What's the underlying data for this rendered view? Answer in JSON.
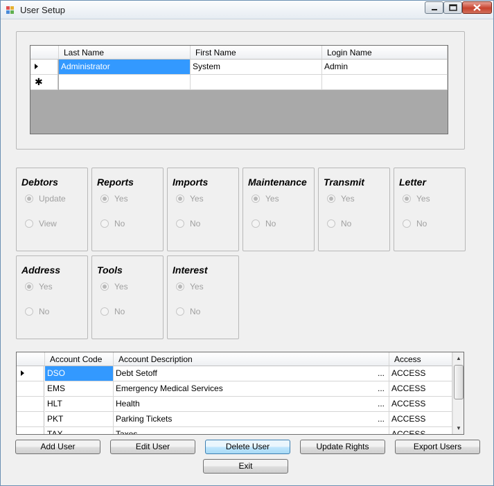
{
  "window": {
    "title": "User Setup"
  },
  "users_grid": {
    "columns": [
      "Last Name",
      "First Name",
      "Login Name"
    ],
    "rows": [
      {
        "last": "Administrator",
        "first": "System",
        "login": "Admin"
      }
    ]
  },
  "rights": {
    "debtors": {
      "title": "Debtors",
      "opt1": "Update",
      "opt2": "View"
    },
    "reports": {
      "title": "Reports",
      "opt1": "Yes",
      "opt2": "No"
    },
    "imports": {
      "title": "Imports",
      "opt1": "Yes",
      "opt2": "No"
    },
    "maintenance": {
      "title": "Maintenance",
      "opt1": "Yes",
      "opt2": "No"
    },
    "transmit": {
      "title": "Transmit",
      "opt1": "Yes",
      "opt2": "No"
    },
    "letter": {
      "title": "Letter",
      "opt1": "Yes",
      "opt2": "No"
    },
    "address": {
      "title": "Address",
      "opt1": "Yes",
      "opt2": "No"
    },
    "tools": {
      "title": "Tools",
      "opt1": "Yes",
      "opt2": "No"
    },
    "interest": {
      "title": "Interest",
      "opt1": "Yes",
      "opt2": "No"
    }
  },
  "accounts_grid": {
    "columns": [
      "Account Code",
      "Account Description",
      "Access"
    ],
    "rows": [
      {
        "code": "DSO",
        "desc": "Debt Setoff",
        "ellipsis": "...",
        "access": "ACCESS"
      },
      {
        "code": "EMS",
        "desc": "Emergency Medical Services",
        "ellipsis": "...",
        "access": "ACCESS"
      },
      {
        "code": "HLT",
        "desc": "Health",
        "ellipsis": "...",
        "access": "ACCESS"
      },
      {
        "code": "PKT",
        "desc": "Parking Tickets",
        "ellipsis": "...",
        "access": "ACCESS"
      },
      {
        "code": "TAX",
        "desc": "Taxes",
        "ellipsis": "...",
        "access": "ACCESS"
      }
    ]
  },
  "buttons": {
    "add_user": "Add User",
    "edit_user": "Edit User",
    "delete_user": "Delete User",
    "update_rights": "Update Rights",
    "export_users": "Export Users",
    "exit": "Exit"
  }
}
